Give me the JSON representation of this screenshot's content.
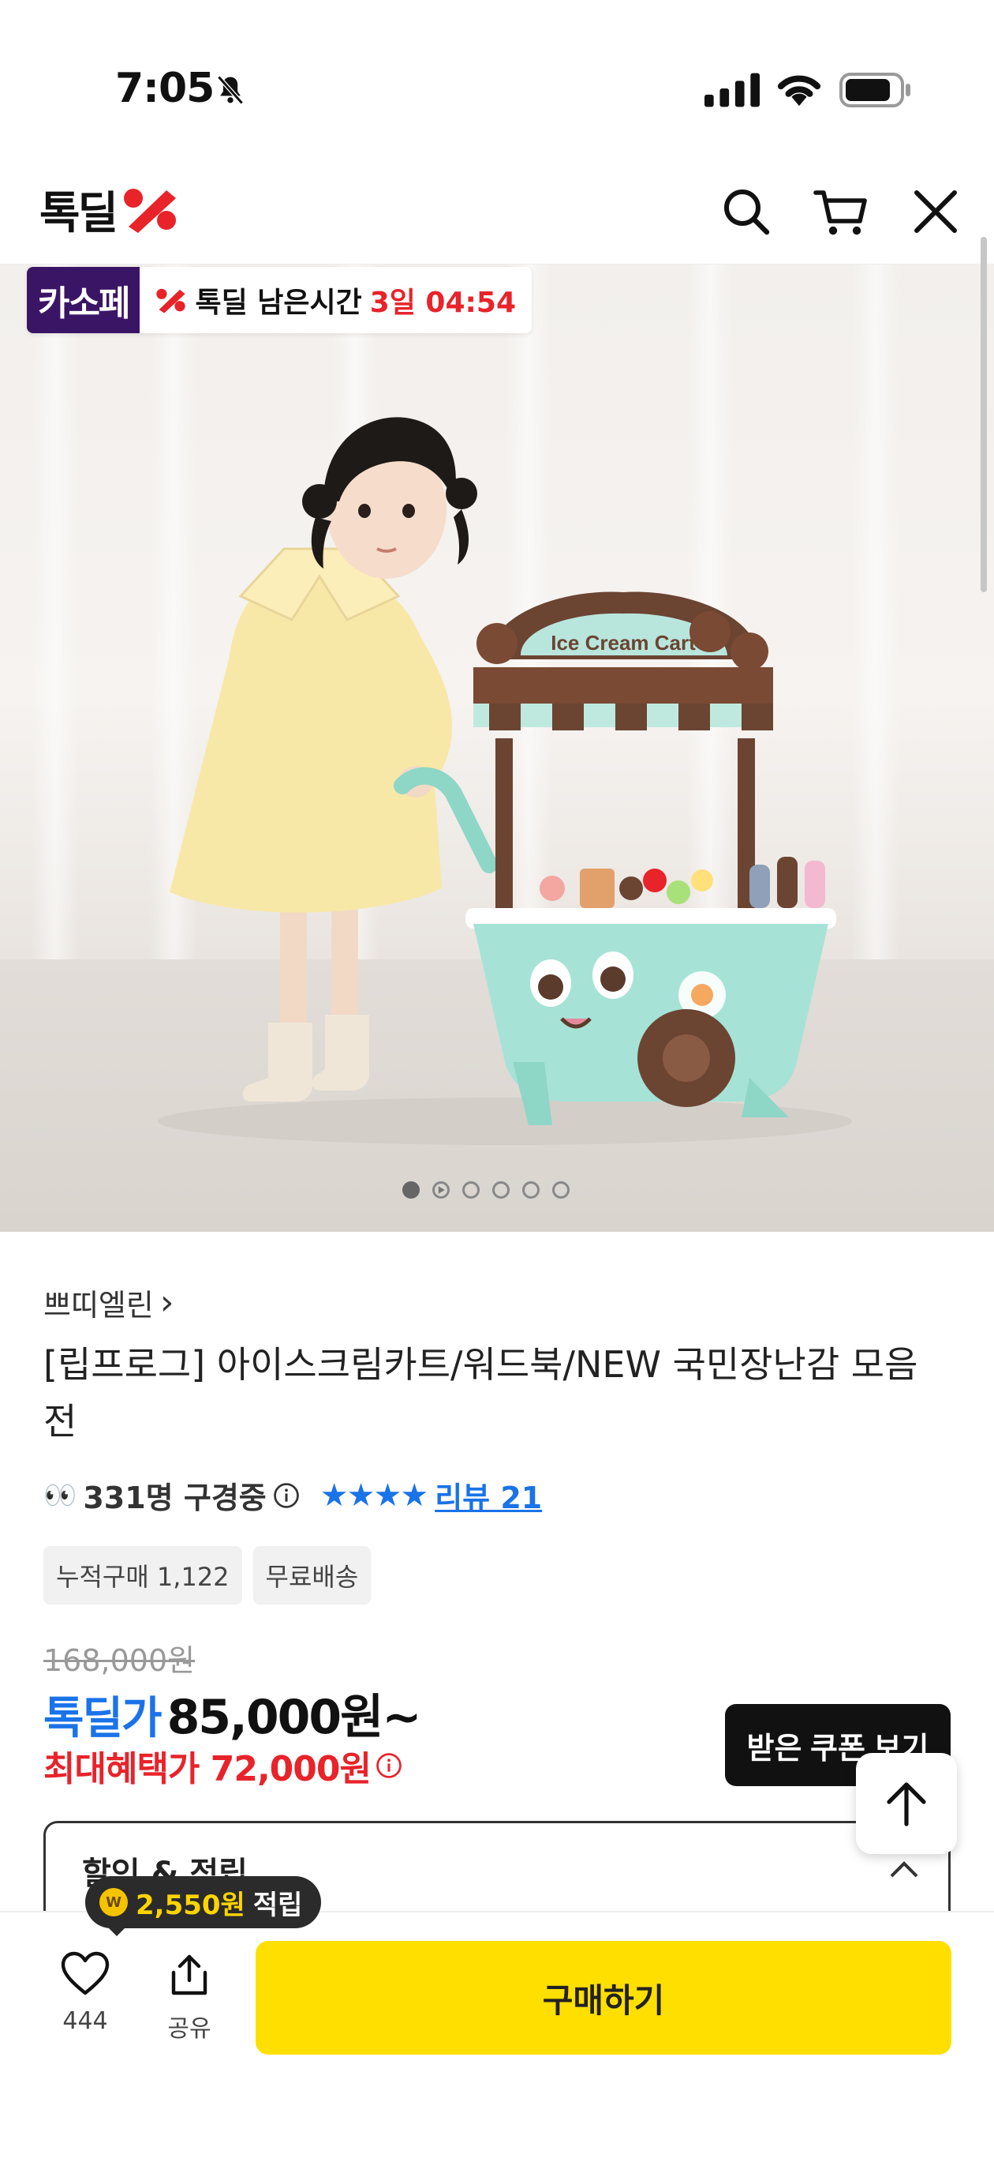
{
  "status_bar": {
    "time": "7:05"
  },
  "header": {
    "logo_text": "톡딜"
  },
  "badge": {
    "kasope": "카소페",
    "deal_label": "톡딜 남은시간",
    "remaining": "3일 04:54"
  },
  "carousel": {
    "count": 6,
    "active_index": 0
  },
  "product": {
    "brand": "쁘띠엘린",
    "brand_chevron": "›",
    "title": "[립프로그] 아이스크림카트/워드북/NEW 국민장난감 모음전",
    "eyes": "👀",
    "watching": "331명 구경중",
    "stars": "★★★★",
    "reviews": "리뷰 21",
    "tags": [
      "누적구매 1,122",
      "무료배송"
    ],
    "original_price": "168,000원",
    "price_label": "톡딜가",
    "price": "85,000원~",
    "max_benefit": "최대혜택가 72,000원",
    "coupon_button": "받은 쿠폰 보기",
    "discount_section": "할인 & 적립"
  },
  "bottom_bar": {
    "points_coin": "W",
    "points_amount": "2,550원",
    "points_suffix": "적립",
    "like_count": "444",
    "share_label": "공유",
    "buy_label": "구매하기"
  },
  "colors": {
    "accent_blue": "#1a73e8",
    "accent_red": "#e8232a",
    "buy_yellow": "#ffdf00",
    "kasope_purple": "#3b1565"
  }
}
